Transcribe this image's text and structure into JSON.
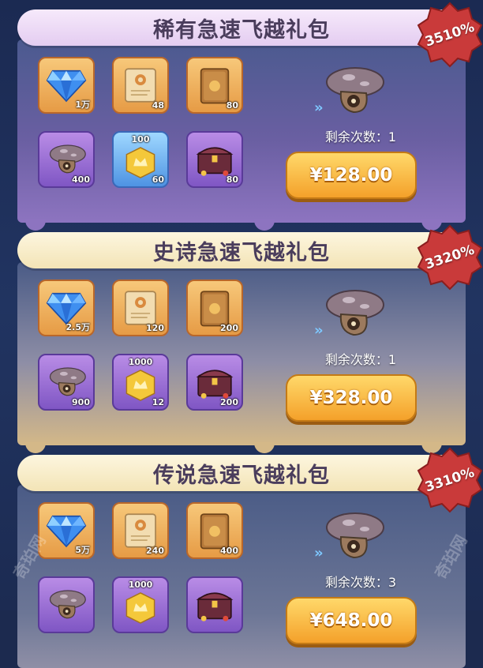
{
  "packs": [
    {
      "title": "稀有急速飞越礼包",
      "badge": "3510%",
      "items": [
        {
          "icon": "diamond-icon",
          "qty": "1万",
          "top": ""
        },
        {
          "icon": "scroll-icon",
          "qty": "48",
          "top": ""
        },
        {
          "icon": "card-icon",
          "qty": "80",
          "top": ""
        },
        {
          "icon": "mushroom-icon",
          "qty": "400",
          "top": ""
        },
        {
          "icon": "crown-coin-icon",
          "qty": "60",
          "top": "100"
        },
        {
          "icon": "chest-icon",
          "qty": "80",
          "top": ""
        }
      ],
      "remaining": "剩余次数：1",
      "price": "¥128.00"
    },
    {
      "title": "史诗急速飞越礼包",
      "badge": "3320%",
      "items": [
        {
          "icon": "diamond-icon",
          "qty": "2.5万",
          "top": ""
        },
        {
          "icon": "scroll-icon",
          "qty": "120",
          "top": ""
        },
        {
          "icon": "card-icon",
          "qty": "200",
          "top": ""
        },
        {
          "icon": "mushroom-icon",
          "qty": "900",
          "top": ""
        },
        {
          "icon": "crown-coin-icon",
          "qty": "12",
          "top": "1000"
        },
        {
          "icon": "chest-icon",
          "qty": "200",
          "top": ""
        }
      ],
      "remaining": "剩余次数：1",
      "price": "¥328.00"
    },
    {
      "title": "传说急速飞越礼包",
      "badge": "3310%",
      "items": [
        {
          "icon": "diamond-icon",
          "qty": "5万",
          "top": ""
        },
        {
          "icon": "scroll-icon",
          "qty": "240",
          "top": ""
        },
        {
          "icon": "card-icon",
          "qty": "400",
          "top": ""
        },
        {
          "icon": "mushroom-icon",
          "qty": "",
          "top": ""
        },
        {
          "icon": "crown-coin-icon",
          "qty": "",
          "top": "1000"
        },
        {
          "icon": "chest-icon",
          "qty": "",
          "top": ""
        }
      ],
      "remaining": "剩余次数：3",
      "price": "¥648.00"
    }
  ],
  "watermark": "奇珀网"
}
